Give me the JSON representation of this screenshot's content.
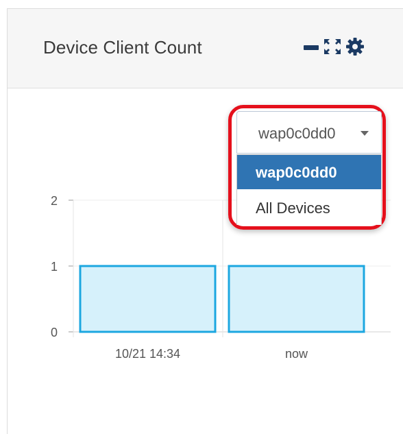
{
  "panel": {
    "title": "Device Client Count",
    "tools": [
      {
        "name": "minimize-icon"
      },
      {
        "name": "expand-icon"
      },
      {
        "name": "gear-icon"
      }
    ]
  },
  "device_select": {
    "selected": "wap0c0dd0",
    "options": [
      "wap0c0dd0",
      "All Devices"
    ],
    "highlighted_index": 0
  },
  "colors": {
    "accent": "#2f74b3",
    "bar_fill": "#d6f1fb",
    "bar_stroke": "#1ca7e0",
    "highlight_ring": "#e5101c",
    "icon": "#1b3a63"
  },
  "chart_data": {
    "type": "bar",
    "categories": [
      "10/21 14:34",
      "now"
    ],
    "values": [
      1,
      1
    ],
    "ylim": [
      0,
      2
    ],
    "yticks": [
      "0",
      "1",
      "2"
    ],
    "grid": true,
    "legend": "none"
  }
}
